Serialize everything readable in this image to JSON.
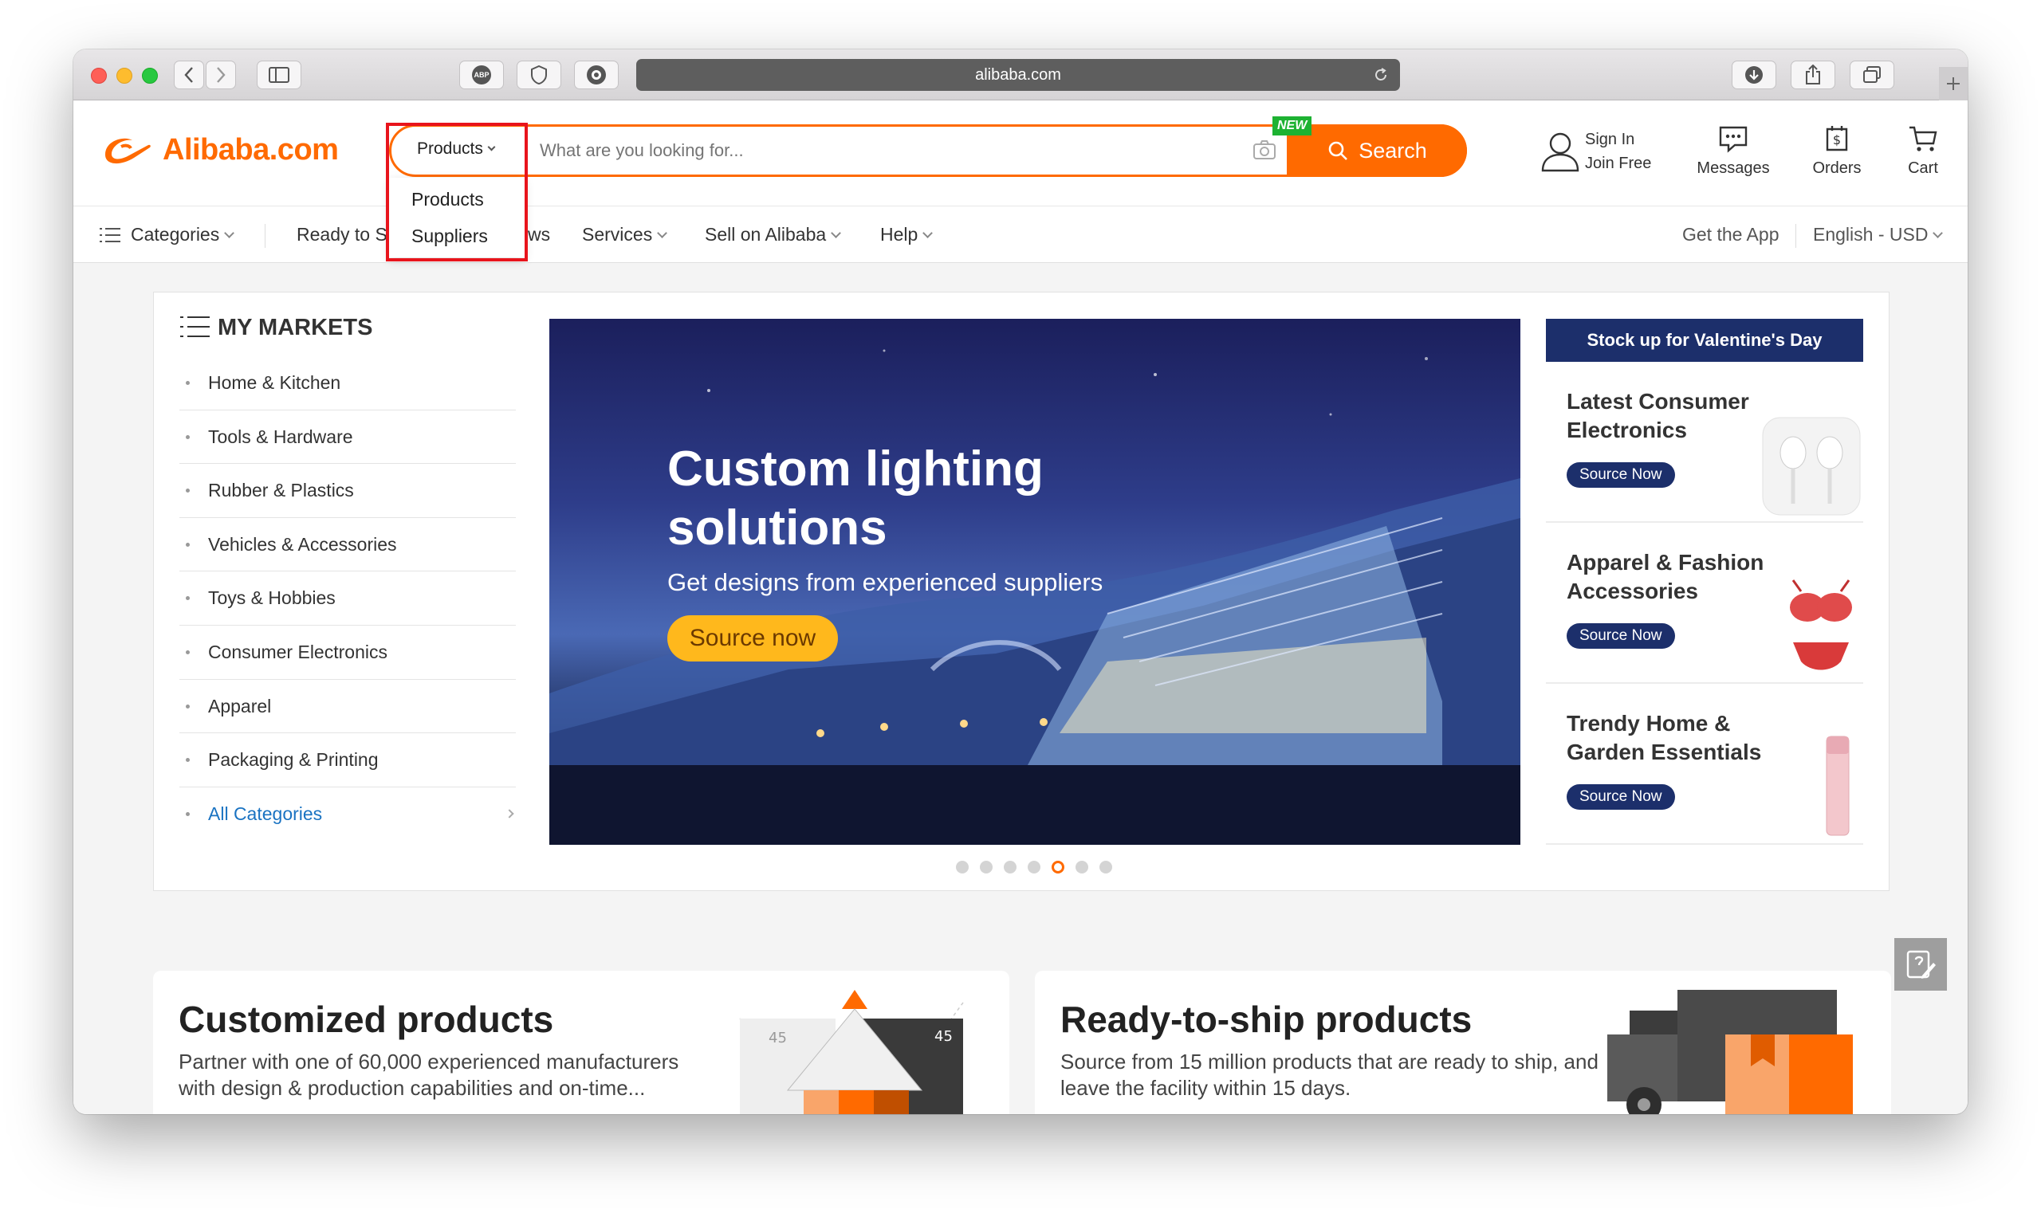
{
  "browser": {
    "url": "alibaba.com",
    "icons": [
      "back-icon",
      "forward-icon",
      "sidebar-icon",
      "abp-icon",
      "shield-icon",
      "grammarly-icon",
      "reload-icon",
      "download-icon",
      "share-icon",
      "tabs-icon",
      "new-tab-icon"
    ],
    "abp_label": "ABP"
  },
  "header": {
    "logo": "Alibaba.com",
    "search_category": "Products",
    "search_placeholder": "What are you looking for...",
    "new_badge": "NEW",
    "search_button": "Search",
    "sign_in": "Sign In",
    "join_free": "Join Free",
    "messages": "Messages",
    "orders": "Orders",
    "cart": "Cart"
  },
  "dropdown": {
    "options": [
      "Products",
      "Suppliers"
    ]
  },
  "navbar": {
    "categories": "Categories",
    "ready_to_ship": "Ready to S",
    "partial_ws": "ws",
    "services": "Services",
    "sell": "Sell on Alibaba",
    "help": "Help",
    "get_app": "Get the App",
    "language": "English - USD"
  },
  "markets": {
    "title": "MY MARKETS",
    "items": [
      "Home & Kitchen",
      "Tools & Hardware",
      "Rubber & Plastics",
      "Vehicles & Accessories",
      "Toys & Hobbies",
      "Consumer Electronics",
      "Apparel",
      "Packaging & Printing",
      "All Categories"
    ]
  },
  "banner": {
    "title_line1": "Custom lighting",
    "title_line2": "solutions",
    "subtitle": "Get designs from experienced suppliers",
    "button": "Source now",
    "slide_count": 7,
    "active_slide": 5
  },
  "promo": {
    "header": "Stock up for Valentine's Day",
    "cards": [
      {
        "title": "Latest Consumer Electronics",
        "button": "Source Now"
      },
      {
        "title": "Apparel & Fashion Accessories",
        "button": "Source Now"
      },
      {
        "title": "Trendy Home & Garden Essentials",
        "button": "Source Now"
      }
    ]
  },
  "bottom": {
    "customized": {
      "title": "Customized products",
      "description": "Partner with one of 60,000 experienced manufacturers with design & production capabilities and on-time...",
      "badge_number": "45"
    },
    "ready": {
      "title": "Ready-to-ship products",
      "description": "Source from 15 million products that are ready to ship, and leave the facility within 15 days."
    }
  },
  "colors": {
    "brand": "#ff6a00",
    "navy": "#1c2f6b",
    "highlight": "#e8141c",
    "link": "#1a73c2"
  }
}
